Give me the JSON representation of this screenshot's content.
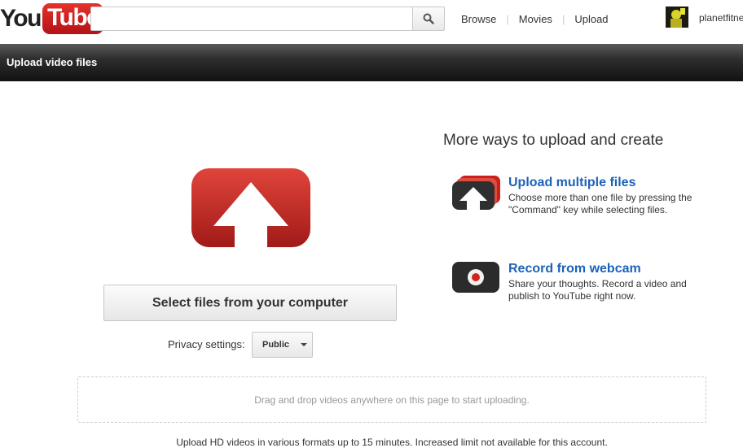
{
  "header": {
    "logo_you": "You",
    "logo_tube": "Tube",
    "search": {
      "value": "",
      "placeholder": ""
    },
    "nav": [
      {
        "label": "Browse"
      },
      {
        "label": "Movies"
      },
      {
        "label": "Upload"
      }
    ],
    "username": "planetfitne"
  },
  "titlebar": {
    "title": "Upload video files"
  },
  "upload": {
    "select_button_label": "Select files from your computer",
    "privacy_label": "Privacy settings:",
    "privacy_value": "Public"
  },
  "more_ways": {
    "heading": "More ways to upload and create",
    "options": [
      {
        "title": "Upload multiple files",
        "description": "Choose more than one file by pressing the \"Command\" key while selecting files.",
        "icon": "upload-multiple-icon"
      },
      {
        "title": "Record from webcam",
        "description": "Share your thoughts. Record a video and publish to YouTube right now.",
        "icon": "webcam-record-icon"
      }
    ]
  },
  "dropzone": {
    "text": "Drag and drop videos anywhere on this page to start uploading."
  },
  "footnote": "Upload HD videos in various formats up to 15 minutes. Increased limit not available for this account.",
  "colors": {
    "brand_red": "#cc181e",
    "link_blue": "#1c62b9",
    "titlebar_dark": "#1a1a1a"
  }
}
